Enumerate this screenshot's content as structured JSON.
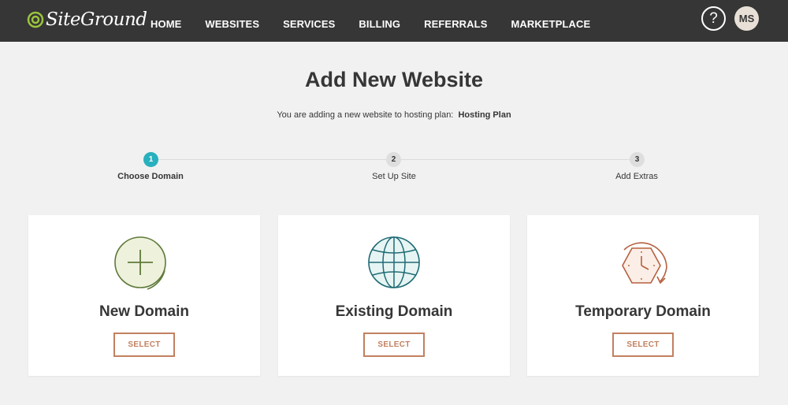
{
  "app": {
    "brand": "SiteGround"
  },
  "nav": {
    "items": [
      "HOME",
      "WEBSITES",
      "SERVICES",
      "BILLING",
      "REFERRALS",
      "MARKETPLACE"
    ]
  },
  "header": {
    "help_symbol": "?",
    "avatar_initials": "MS"
  },
  "page": {
    "title": "Add New Website",
    "subtitle_prefix": "You are adding a new website to hosting plan:",
    "plan_name": "Hosting Plan"
  },
  "stepper": {
    "steps": [
      {
        "number": "1",
        "label": "Choose Domain",
        "active": true
      },
      {
        "number": "2",
        "label": "Set Up Site",
        "active": false
      },
      {
        "number": "3",
        "label": "Add Extras",
        "active": false
      }
    ]
  },
  "cards": [
    {
      "title": "New Domain",
      "button": "SELECT",
      "icon": "plus-circle-icon"
    },
    {
      "title": "Existing Domain",
      "button": "SELECT",
      "icon": "globe-icon"
    },
    {
      "title": "Temporary Domain",
      "button": "SELECT",
      "icon": "clock-icon"
    }
  ],
  "colors": {
    "topbar": "#363636",
    "accent_teal": "#28b0be",
    "button_accent": "#c2805f",
    "new_domain_icon": "#5e7a3a",
    "existing_domain_icon": "#1f6b74",
    "temporary_domain_icon": "#b5603f"
  }
}
